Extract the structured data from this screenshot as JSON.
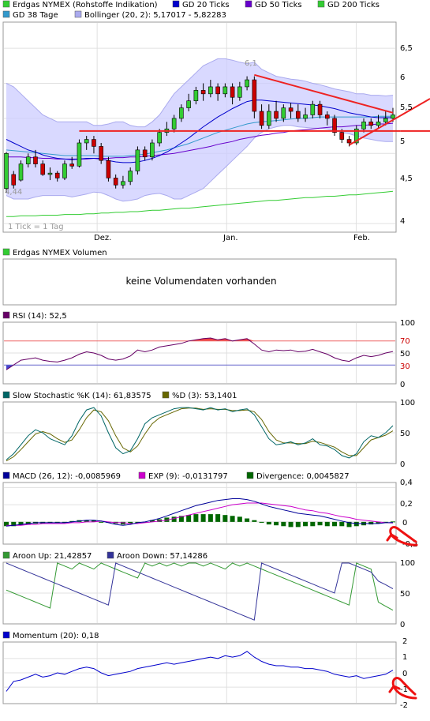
{
  "colors": {
    "price": "#000000",
    "gd20": "#0000cc",
    "gd50": "#6600cc",
    "gd200": "#33cc33",
    "gd38": "#3399cc",
    "bollinger": "#aaaaee",
    "bollinger_fill": "#ccccff",
    "up": "#33cc33",
    "down": "#cc0000",
    "trend": "#ee2222",
    "grid": "#e0e0e0",
    "rsi": "#660066",
    "stoch_k": "#006666",
    "stoch_d": "#666600",
    "macd": "#000099",
    "exp": "#cc00cc",
    "divergence": "#006600",
    "aroon_up": "#339933",
    "aroon_down": "#333399",
    "momentum": "#0000cc"
  },
  "price_panel": {
    "legend": [
      {
        "key": "price",
        "label": "Erdgas NYMEX (Rohstoffe Indikation)"
      },
      {
        "key": "gd20",
        "label": "GD 20 Ticks"
      },
      {
        "key": "gd50",
        "label": "GD 50 Ticks"
      },
      {
        "key": "gd200",
        "label": "GD 200 Ticks"
      },
      {
        "key": "gd38",
        "label": "GD 38 Tage"
      },
      {
        "key": "bollinger",
        "label": "Bollinger (20, 2): 5,17017 - 5,82283"
      }
    ],
    "high_label": "6,1",
    "low_label": "4,44",
    "note": "1 Tick = 1 Tag",
    "y_ticks": [
      "6,5",
      "6",
      "5,5",
      "5",
      "4,5",
      "4"
    ],
    "x_ticks": [
      "Dez.",
      "Jan.",
      "Feb."
    ]
  },
  "volume_panel": {
    "legend": "Erdgas NYMEX Volumen",
    "message": "keine Volumendaten vorhanden"
  },
  "rsi_panel": {
    "legend": "RSI (14): 52,5",
    "y_ticks": [
      "100",
      "70",
      "50",
      "30",
      "0"
    ]
  },
  "stoch_panel": {
    "legend_k": "Slow Stochastic %K (14): 61,83575",
    "legend_d": "%D (3): 53,1401",
    "y_ticks": [
      "100",
      "50",
      "0"
    ]
  },
  "macd_panel": {
    "legend_macd": "MACD (26, 12): -0,0085969",
    "legend_exp": "EXP (9): -0,0131797",
    "legend_div": "Divergence: 0,0045827",
    "y_ticks": [
      "0,4",
      "0,2",
      "0",
      "-0,2"
    ]
  },
  "aroon_panel": {
    "legend_up": "Aroon Up: 21,42857",
    "legend_down": "Aroon Down: 57,14286",
    "y_ticks": [
      "100",
      "50",
      "0"
    ]
  },
  "momentum_panel": {
    "legend": "Momentum (20): 0,18",
    "y_ticks": [
      "2",
      "1",
      "0",
      "-1",
      "-2"
    ]
  },
  "chart_data": {
    "type": "line",
    "title": "Erdgas NYMEX (Rohstoffe Indikation)",
    "x_axis": [
      "Dez.",
      "Jan.",
      "Feb."
    ],
    "price": {
      "ylim": [
        3.9,
        6.85
      ],
      "candles": [
        [
          4.5,
          5.0,
          5.02,
          4.44
        ],
        [
          4.7,
          4.55,
          4.75,
          4.5
        ],
        [
          4.62,
          4.85,
          4.9,
          4.6
        ],
        [
          4.85,
          4.95,
          5.0,
          4.8
        ],
        [
          4.95,
          4.85,
          5.05,
          4.8
        ],
        [
          4.85,
          4.7,
          4.9,
          4.68
        ],
        [
          4.7,
          4.72,
          4.8,
          4.62
        ],
        [
          4.72,
          4.65,
          4.75,
          4.6
        ],
        [
          4.65,
          4.85,
          4.9,
          4.62
        ],
        [
          4.85,
          4.82,
          4.95,
          4.78
        ],
        [
          4.82,
          5.15,
          5.2,
          4.8
        ],
        [
          5.15,
          5.2,
          5.25,
          5.05
        ],
        [
          5.2,
          5.1,
          5.25,
          5.0
        ],
        [
          5.1,
          4.9,
          5.15,
          4.85
        ],
        [
          4.9,
          4.65,
          4.95,
          4.6
        ],
        [
          4.65,
          4.55,
          4.7,
          4.5
        ],
        [
          4.55,
          4.6,
          4.68,
          4.5
        ],
        [
          4.6,
          4.75,
          4.8,
          4.55
        ],
        [
          4.75,
          5.05,
          5.1,
          4.7
        ],
        [
          5.05,
          4.95,
          5.1,
          4.9
        ],
        [
          4.95,
          5.15,
          5.2,
          4.9
        ],
        [
          5.15,
          5.3,
          5.35,
          5.1
        ],
        [
          5.3,
          5.35,
          5.45,
          5.25
        ],
        [
          5.35,
          5.5,
          5.55,
          5.3
        ],
        [
          5.5,
          5.65,
          5.7,
          5.45
        ],
        [
          5.65,
          5.75,
          5.85,
          5.6
        ],
        [
          5.75,
          5.9,
          5.95,
          5.7
        ],
        [
          5.9,
          5.85,
          6.0,
          5.75
        ],
        [
          5.85,
          5.95,
          6.05,
          5.8
        ],
        [
          5.95,
          5.85,
          6.0,
          5.75
        ],
        [
          5.85,
          5.95,
          6.0,
          5.8
        ],
        [
          5.95,
          5.8,
          6.0,
          5.7
        ],
        [
          5.8,
          5.95,
          6.02,
          5.75
        ],
        [
          5.95,
          6.05,
          6.1,
          5.9
        ],
        [
          6.05,
          5.6,
          6.1,
          5.5
        ],
        [
          5.6,
          5.4,
          5.7,
          5.35
        ],
        [
          5.4,
          5.6,
          5.7,
          5.35
        ],
        [
          5.6,
          5.5,
          5.75,
          5.45
        ],
        [
          5.5,
          5.65,
          5.7,
          5.45
        ],
        [
          5.65,
          5.6,
          5.72,
          5.5
        ],
        [
          5.6,
          5.5,
          5.7,
          5.45
        ],
        [
          5.5,
          5.55,
          5.65,
          5.45
        ],
        [
          5.55,
          5.7,
          5.75,
          5.5
        ],
        [
          5.7,
          5.55,
          5.75,
          5.5
        ],
        [
          5.55,
          5.5,
          5.6,
          5.4
        ],
        [
          5.5,
          5.3,
          5.55,
          5.25
        ],
        [
          5.3,
          5.2,
          5.35,
          5.15
        ],
        [
          5.2,
          5.15,
          5.25,
          5.1
        ],
        [
          5.15,
          5.35,
          5.4,
          5.12
        ],
        [
          5.35,
          5.45,
          5.5,
          5.3
        ],
        [
          5.45,
          5.4,
          5.5,
          5.35
        ],
        [
          5.4,
          5.45,
          5.55,
          5.35
        ],
        [
          5.45,
          5.5,
          5.6,
          5.4
        ],
        [
          5.5,
          5.55,
          5.65,
          5.45
        ]
      ],
      "gd20": [
        5.2,
        5.15,
        5.1,
        5.05,
        5.02,
        4.98,
        4.95,
        4.93,
        4.92,
        4.91,
        4.92,
        4.93,
        4.93,
        4.92,
        4.9,
        4.88,
        4.87,
        4.87,
        4.88,
        4.9,
        4.93,
        4.97,
        5.02,
        5.08,
        5.15,
        5.22,
        5.3,
        5.38,
        5.45,
        5.52,
        5.58,
        5.64,
        5.69,
        5.74,
        5.76,
        5.76,
        5.75,
        5.74,
        5.73,
        5.72,
        5.71,
        5.7,
        5.69,
        5.68,
        5.66,
        5.64,
        5.61,
        5.58,
        5.56,
        5.54,
        5.52,
        5.51,
        5.51,
        5.51
      ],
      "gd50": [
        4.95,
        4.95,
        4.95,
        4.94,
        4.94,
        4.93,
        4.93,
        4.92,
        4.92,
        4.92,
        4.92,
        4.92,
        4.93,
        4.93,
        4.93,
        4.94,
        4.94,
        4.95,
        4.95,
        4.96,
        4.97,
        4.98,
        4.99,
        5.0,
        5.02,
        5.04,
        5.06,
        5.08,
        5.1,
        5.13,
        5.15,
        5.17,
        5.2,
        5.22,
        5.24,
        5.26,
        5.27,
        5.29,
        5.3,
        5.32,
        5.33,
        5.34,
        5.35,
        5.36,
        5.37,
        5.38,
        5.38,
        5.39,
        5.4,
        5.4,
        5.41,
        5.42,
        5.42,
        5.43
      ],
      "gd38": [
        5.05,
        5.04,
        5.03,
        5.02,
        5.01,
        5.0,
        4.99,
        4.98,
        4.97,
        4.97,
        4.97,
        4.97,
        4.97,
        4.96,
        4.96,
        4.96,
        4.96,
        4.97,
        4.98,
        4.99,
        5.01,
        5.03,
        5.05,
        5.08,
        5.11,
        5.14,
        5.18,
        5.22,
        5.26,
        5.3,
        5.33,
        5.36,
        5.39,
        5.42,
        5.44,
        5.45,
        5.46,
        5.47,
        5.48,
        5.49,
        5.5,
        5.5,
        5.51,
        5.52,
        5.52,
        5.52,
        5.52,
        5.52,
        5.52,
        5.52,
        5.52,
        5.53,
        5.53,
        5.53
      ],
      "gd200": [
        4.1,
        4.1,
        4.11,
        4.11,
        4.11,
        4.12,
        4.12,
        4.12,
        4.13,
        4.13,
        4.13,
        4.14,
        4.14,
        4.15,
        4.15,
        4.16,
        4.16,
        4.17,
        4.17,
        4.18,
        4.19,
        4.19,
        4.2,
        4.21,
        4.22,
        4.22,
        4.23,
        4.24,
        4.25,
        4.26,
        4.27,
        4.28,
        4.29,
        4.3,
        4.31,
        4.32,
        4.33,
        4.33,
        4.34,
        4.35,
        4.36,
        4.37,
        4.37,
        4.38,
        4.39,
        4.39,
        4.4,
        4.41,
        4.41,
        4.42,
        4.43,
        4.44,
        4.45,
        4.46
      ],
      "boll_upper": [
        6.0,
        5.95,
        5.85,
        5.75,
        5.65,
        5.55,
        5.5,
        5.45,
        5.45,
        5.45,
        5.45,
        5.45,
        5.4,
        5.4,
        5.42,
        5.45,
        5.45,
        5.4,
        5.38,
        5.38,
        5.45,
        5.55,
        5.7,
        5.85,
        5.95,
        6.05,
        6.15,
        6.25,
        6.3,
        6.35,
        6.35,
        6.33,
        6.3,
        6.28,
        6.3,
        6.2,
        6.15,
        6.1,
        6.08,
        6.06,
        6.05,
        6.03,
        6.0,
        5.98,
        5.95,
        5.92,
        5.9,
        5.88,
        5.85,
        5.85,
        5.83,
        5.83,
        5.82,
        5.83
      ],
      "boll_lower": [
        4.4,
        4.35,
        4.35,
        4.35,
        4.38,
        4.4,
        4.4,
        4.4,
        4.4,
        4.38,
        4.4,
        4.42,
        4.45,
        4.44,
        4.4,
        4.35,
        4.32,
        4.33,
        4.35,
        4.4,
        4.42,
        4.43,
        4.4,
        4.35,
        4.35,
        4.4,
        4.45,
        4.5,
        4.6,
        4.7,
        4.8,
        4.9,
        5.0,
        5.1,
        5.22,
        5.3,
        5.35,
        5.38,
        5.4,
        5.4,
        5.38,
        5.37,
        5.36,
        5.36,
        5.35,
        5.33,
        5.3,
        5.28,
        5.25,
        5.22,
        5.2,
        5.18,
        5.17,
        5.17
      ],
      "resistance": [
        [
          10,
          5.32
        ],
        [
          54,
          5.32
        ]
      ],
      "down_trend": [
        [
          34,
          6.12
        ],
        [
          53,
          5.58
        ]
      ],
      "up_trend": [
        [
          47,
          5.12
        ],
        [
          56,
          5.55
        ]
      ]
    },
    "rsi": {
      "ylim": [
        0,
        100
      ],
      "levels": [
        70,
        30
      ],
      "values": [
        22,
        30,
        38,
        40,
        42,
        38,
        36,
        35,
        38,
        42,
        48,
        52,
        50,
        46,
        40,
        38,
        40,
        45,
        55,
        52,
        55,
        60,
        62,
        64,
        66,
        70,
        72,
        74,
        75,
        72,
        74,
        70,
        72,
        74,
        65,
        55,
        52,
        55,
        54,
        55,
        52,
        53,
        56,
        52,
        48,
        42,
        38,
        36,
        42,
        46,
        44,
        46,
        50,
        52.5
      ]
    },
    "stochastic": {
      "ylim": [
        0,
        100
      ],
      "k": [
        5,
        15,
        30,
        45,
        55,
        50,
        40,
        35,
        30,
        45,
        70,
        88,
        92,
        78,
        50,
        25,
        15,
        20,
        40,
        65,
        75,
        80,
        85,
        90,
        92,
        92,
        90,
        88,
        92,
        88,
        90,
        85,
        88,
        90,
        80,
        60,
        40,
        30,
        32,
        35,
        30,
        33,
        40,
        30,
        28,
        22,
        12,
        8,
        15,
        35,
        45,
        42,
        50,
        61.8
      ],
      "d": [
        3,
        10,
        22,
        35,
        48,
        52,
        48,
        40,
        34,
        38,
        55,
        75,
        88,
        85,
        70,
        45,
        25,
        18,
        28,
        48,
        65,
        75,
        80,
        85,
        90,
        91,
        91,
        89,
        90,
        89,
        89,
        87,
        87,
        88,
        85,
        72,
        52,
        38,
        33,
        33,
        32,
        32,
        36,
        34,
        30,
        26,
        18,
        12,
        12,
        25,
        38,
        42,
        46,
        53.1
      ]
    },
    "macd": {
      "ylim": [
        -0.25,
        0.45
      ],
      "macd": [
        -0.05,
        -0.04,
        -0.03,
        -0.02,
        -0.01,
        -0.01,
        -0.01,
        -0.01,
        -0.01,
        0.0,
        0.01,
        0.02,
        0.02,
        0.01,
        -0.01,
        -0.03,
        -0.04,
        -0.03,
        -0.01,
        0.0,
        0.02,
        0.04,
        0.07,
        0.1,
        0.13,
        0.16,
        0.19,
        0.21,
        0.23,
        0.25,
        0.26,
        0.27,
        0.27,
        0.26,
        0.24,
        0.21,
        0.18,
        0.16,
        0.14,
        0.12,
        0.1,
        0.09,
        0.08,
        0.07,
        0.05,
        0.03,
        0.01,
        -0.01,
        -0.02,
        -0.02,
        -0.02,
        -0.02,
        -0.01,
        -0.0086
      ],
      "exp": [
        -0.04,
        -0.04,
        -0.04,
        -0.03,
        -0.03,
        -0.02,
        -0.02,
        -0.02,
        -0.02,
        -0.01,
        -0.01,
        0.0,
        0.0,
        0.01,
        0.0,
        -0.01,
        -0.01,
        -0.02,
        -0.02,
        -0.01,
        0.0,
        0.01,
        0.02,
        0.04,
        0.06,
        0.08,
        0.1,
        0.12,
        0.14,
        0.16,
        0.18,
        0.2,
        0.21,
        0.22,
        0.22,
        0.22,
        0.21,
        0.2,
        0.19,
        0.18,
        0.16,
        0.14,
        0.13,
        0.11,
        0.1,
        0.08,
        0.06,
        0.05,
        0.03,
        0.02,
        0.01,
        0.0,
        -0.01,
        -0.0132
      ],
      "divergence": [
        -0.05,
        -0.05,
        -0.04,
        -0.03,
        -0.02,
        -0.02,
        -0.01,
        -0.01,
        0.0,
        0.01,
        0.02,
        0.02,
        0.02,
        0.0,
        -0.01,
        -0.02,
        -0.03,
        -0.02,
        -0.01,
        0.0,
        0.02,
        0.03,
        0.05,
        0.06,
        0.07,
        0.08,
        0.09,
        0.09,
        0.09,
        0.09,
        0.08,
        0.07,
        0.06,
        0.04,
        0.02,
        -0.01,
        -0.03,
        -0.04,
        -0.05,
        -0.06,
        -0.06,
        -0.05,
        -0.05,
        -0.04,
        -0.05,
        -0.05,
        -0.05,
        -0.06,
        -0.05,
        -0.04,
        -0.03,
        -0.02,
        -0.01,
        0.0046
      ]
    },
    "aroon": {
      "ylim": [
        0,
        100
      ],
      "up": [
        55,
        50,
        45,
        40,
        35,
        30,
        25,
        100,
        95,
        90,
        100,
        95,
        90,
        100,
        95,
        90,
        85,
        80,
        75,
        100,
        95,
        100,
        95,
        100,
        95,
        100,
        100,
        95,
        100,
        95,
        90,
        100,
        95,
        100,
        95,
        90,
        85,
        80,
        75,
        70,
        65,
        60,
        55,
        50,
        45,
        40,
        35,
        30,
        100,
        95,
        90,
        35,
        28,
        21.4
      ],
      "down": [
        100,
        95,
        90,
        85,
        80,
        75,
        70,
        65,
        60,
        55,
        50,
        45,
        40,
        35,
        30,
        100,
        95,
        90,
        85,
        80,
        75,
        70,
        65,
        60,
        55,
        50,
        45,
        40,
        35,
        30,
        25,
        20,
        15,
        10,
        5,
        100,
        95,
        90,
        85,
        80,
        75,
        70,
        65,
        60,
        55,
        50,
        100,
        100,
        95,
        90,
        85,
        70,
        64,
        57.1
      ]
    },
    "momentum": {
      "ylim": [
        -2.1,
        2.1
      ],
      "values": [
        -1.3,
        -0.6,
        -0.5,
        -0.3,
        -0.1,
        -0.3,
        -0.2,
        0.0,
        -0.1,
        0.1,
        0.3,
        0.4,
        0.3,
        0.0,
        -0.2,
        -0.1,
        0.0,
        0.1,
        0.3,
        0.4,
        0.5,
        0.6,
        0.7,
        0.6,
        0.7,
        0.8,
        0.9,
        1.0,
        1.1,
        1.0,
        1.2,
        1.1,
        1.2,
        1.5,
        1.1,
        0.8,
        0.6,
        0.5,
        0.5,
        0.4,
        0.4,
        0.3,
        0.3,
        0.2,
        0.1,
        -0.1,
        -0.2,
        -0.3,
        -0.2,
        -0.4,
        -0.3,
        -0.2,
        -0.1,
        0.18
      ]
    }
  }
}
